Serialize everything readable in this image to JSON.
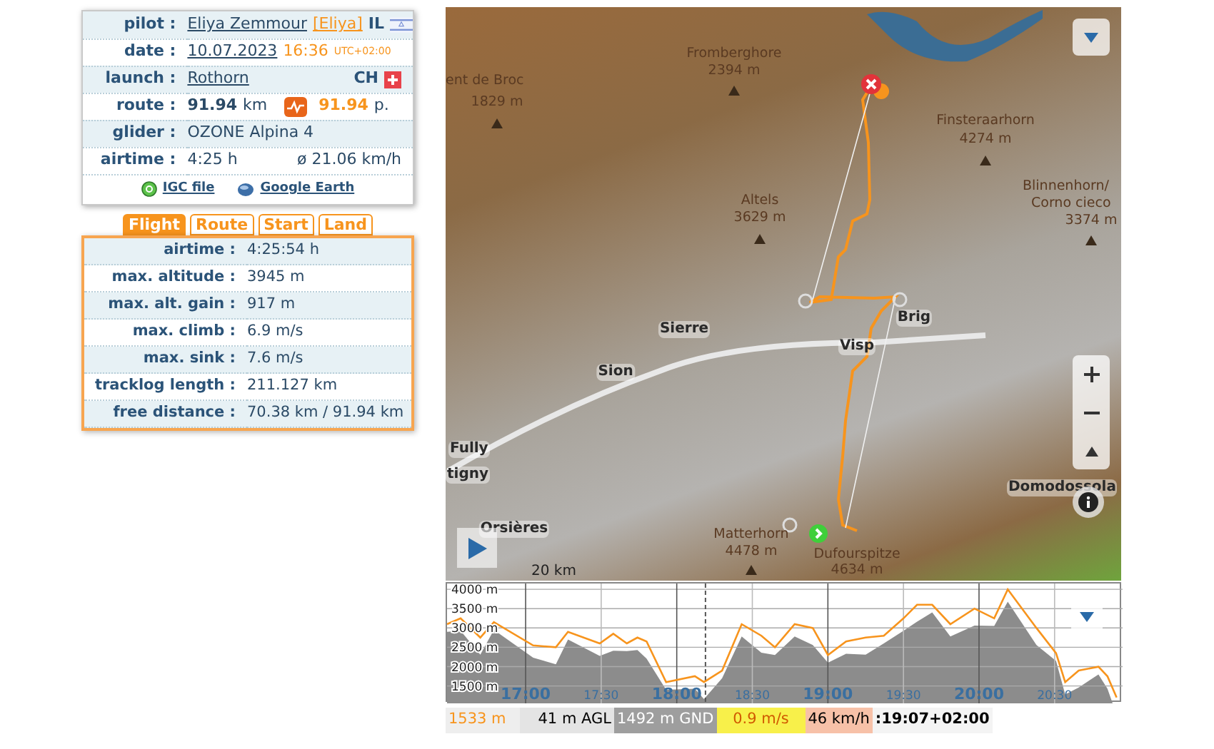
{
  "flight_info": {
    "pilot": {
      "label": "pilot :",
      "name": "Eliya Zemmour",
      "nickname": "[Eliya]",
      "country": "IL"
    },
    "date": {
      "label": "date :",
      "date": "10.07.2023",
      "time": "16:36",
      "timezone": "UTC+02:00"
    },
    "launch": {
      "label": "launch :",
      "site": "Rothorn",
      "country": "CH"
    },
    "route": {
      "label": "route :",
      "distance": "91.94",
      "unit": "km",
      "points": "91.94",
      "points_unit": "p."
    },
    "glider": {
      "label": "glider :",
      "value": "OZONE Alpina 4"
    },
    "airtime": {
      "label": "airtime :",
      "value": "4:25 h",
      "speed": "ø 21.06 km/h"
    },
    "links": [
      "IGC file",
      "Google Earth"
    ]
  },
  "tabs": [
    {
      "label": "Flight",
      "selected": true
    },
    {
      "label": "Route",
      "selected": false
    },
    {
      "label": "Start",
      "selected": false
    },
    {
      "label": "Land",
      "selected": false
    }
  ],
  "stats": [
    {
      "label": "airtime :",
      "value": "4:25:54 h"
    },
    {
      "label": "max. altitude :",
      "value": "3945 m"
    },
    {
      "label": "max. alt. gain :",
      "value": "917 m"
    },
    {
      "label": "max. climb :",
      "value": "6.9 m/s"
    },
    {
      "label": "max. sink :",
      "value": "7.6 m/s"
    },
    {
      "label": "tracklog length :",
      "value": "211.127 km"
    },
    {
      "label": "free distance :",
      "value": "70.38 km / 91.94 km"
    }
  ],
  "map": {
    "labels": [
      {
        "text": "ent de Broc",
        "kind": "place"
      },
      {
        "text": "1829 m",
        "kind": "height"
      },
      {
        "text": "Fromberghore",
        "kind": "place"
      },
      {
        "text": "2394 m",
        "kind": "height"
      },
      {
        "text": "Finsteraarhorn",
        "kind": "place"
      },
      {
        "text": "4274 m",
        "kind": "height"
      },
      {
        "text": "Altels",
        "kind": "place"
      },
      {
        "text": "3629 m",
        "kind": "height"
      },
      {
        "text": "Blinnenhorn/",
        "kind": "place"
      },
      {
        "text": "Corno cieco",
        "kind": "place"
      },
      {
        "text": "3374 m",
        "kind": "height"
      },
      {
        "text": "Sierre",
        "kind": "town"
      },
      {
        "text": "Visp",
        "kind": "town"
      },
      {
        "text": "Brig",
        "kind": "town"
      },
      {
        "text": "Sion",
        "kind": "town"
      },
      {
        "text": "Fully",
        "kind": "town"
      },
      {
        "text": "tigny",
        "kind": "town"
      },
      {
        "text": "Orsières",
        "kind": "town"
      },
      {
        "text": "Domodossola",
        "kind": "town"
      },
      {
        "text": "Matterhorn",
        "kind": "place"
      },
      {
        "text": "4478 m",
        "kind": "height"
      },
      {
        "text": "Dufourspitze",
        "kind": "place"
      },
      {
        "text": "4634 m",
        "kind": "height"
      }
    ],
    "scale": "20 km"
  },
  "profile": {
    "chart_data": {
      "type": "line",
      "grid": true,
      "ref_lines": [
        {
          "axis": "x",
          "value": 18.19
        }
      ],
      "xlim": [
        16.48,
        20.95
      ],
      "ylim": [
        1050,
        4150
      ],
      "x": [
        16.48,
        16.57,
        16.7,
        16.79,
        17.05,
        17.2,
        17.28,
        17.49,
        17.58,
        17.67,
        17.74,
        17.8,
        17.93,
        18.12,
        18.18,
        18.3,
        18.43,
        18.56,
        18.65,
        18.78,
        18.9,
        19.0,
        19.12,
        19.25,
        19.37,
        19.5,
        19.59,
        19.69,
        19.81,
        19.97,
        20.1,
        20.19,
        20.38,
        20.51,
        20.57,
        20.66,
        20.79,
        20.85,
        20.91
      ],
      "series": [
        {
          "color": "#f7941d",
          "values": [
            3100,
            3250,
            2750,
            3150,
            2550,
            2500,
            2900,
            2600,
            2850,
            2600,
            2750,
            2650,
            1600,
            1750,
            1600,
            1900,
            3100,
            2800,
            2500,
            3100,
            3000,
            2300,
            2650,
            2750,
            2800,
            3250,
            3600,
            3600,
            3100,
            3500,
            3250,
            4000,
            3000,
            2350,
            1600,
            1900,
            2000,
            1750,
            1200
          ]
        }
      ],
      "yticks": [
        {
          "value": 1500,
          "label": "1500 m"
        },
        {
          "value": 2000,
          "label": "2000 m"
        },
        {
          "value": 2500,
          "label": "2500 m"
        },
        {
          "value": 3000,
          "label": "3000 m"
        },
        {
          "value": 3500,
          "label": "3500 m"
        },
        {
          "value": 4000,
          "label": "4000 m"
        }
      ],
      "xticks": [
        {
          "value": 17,
          "label": "17:00"
        },
        {
          "value": 17.5,
          "label": "17:30"
        },
        {
          "value": 18,
          "label": "18:00"
        },
        {
          "value": 18.5,
          "label": "18:30"
        },
        {
          "value": 19,
          "label": "19:00"
        },
        {
          "value": 19.5,
          "label": "19:30"
        },
        {
          "value": 20,
          "label": "20:00"
        },
        {
          "value": 20.5,
          "label": "20:30"
        }
      ]
    }
  },
  "status_bar": [
    {
      "kind": "altitude",
      "text": "1533 m"
    },
    {
      "kind": "agl",
      "text": "41 m AGL"
    },
    {
      "kind": "gnd",
      "text": "1492 m GND"
    },
    {
      "kind": "vario",
      "text": "0.9 m/s"
    },
    {
      "kind": "speed",
      "text": "46 km/h"
    },
    {
      "kind": "time",
      "text": ":19:07+02:00"
    }
  ]
}
